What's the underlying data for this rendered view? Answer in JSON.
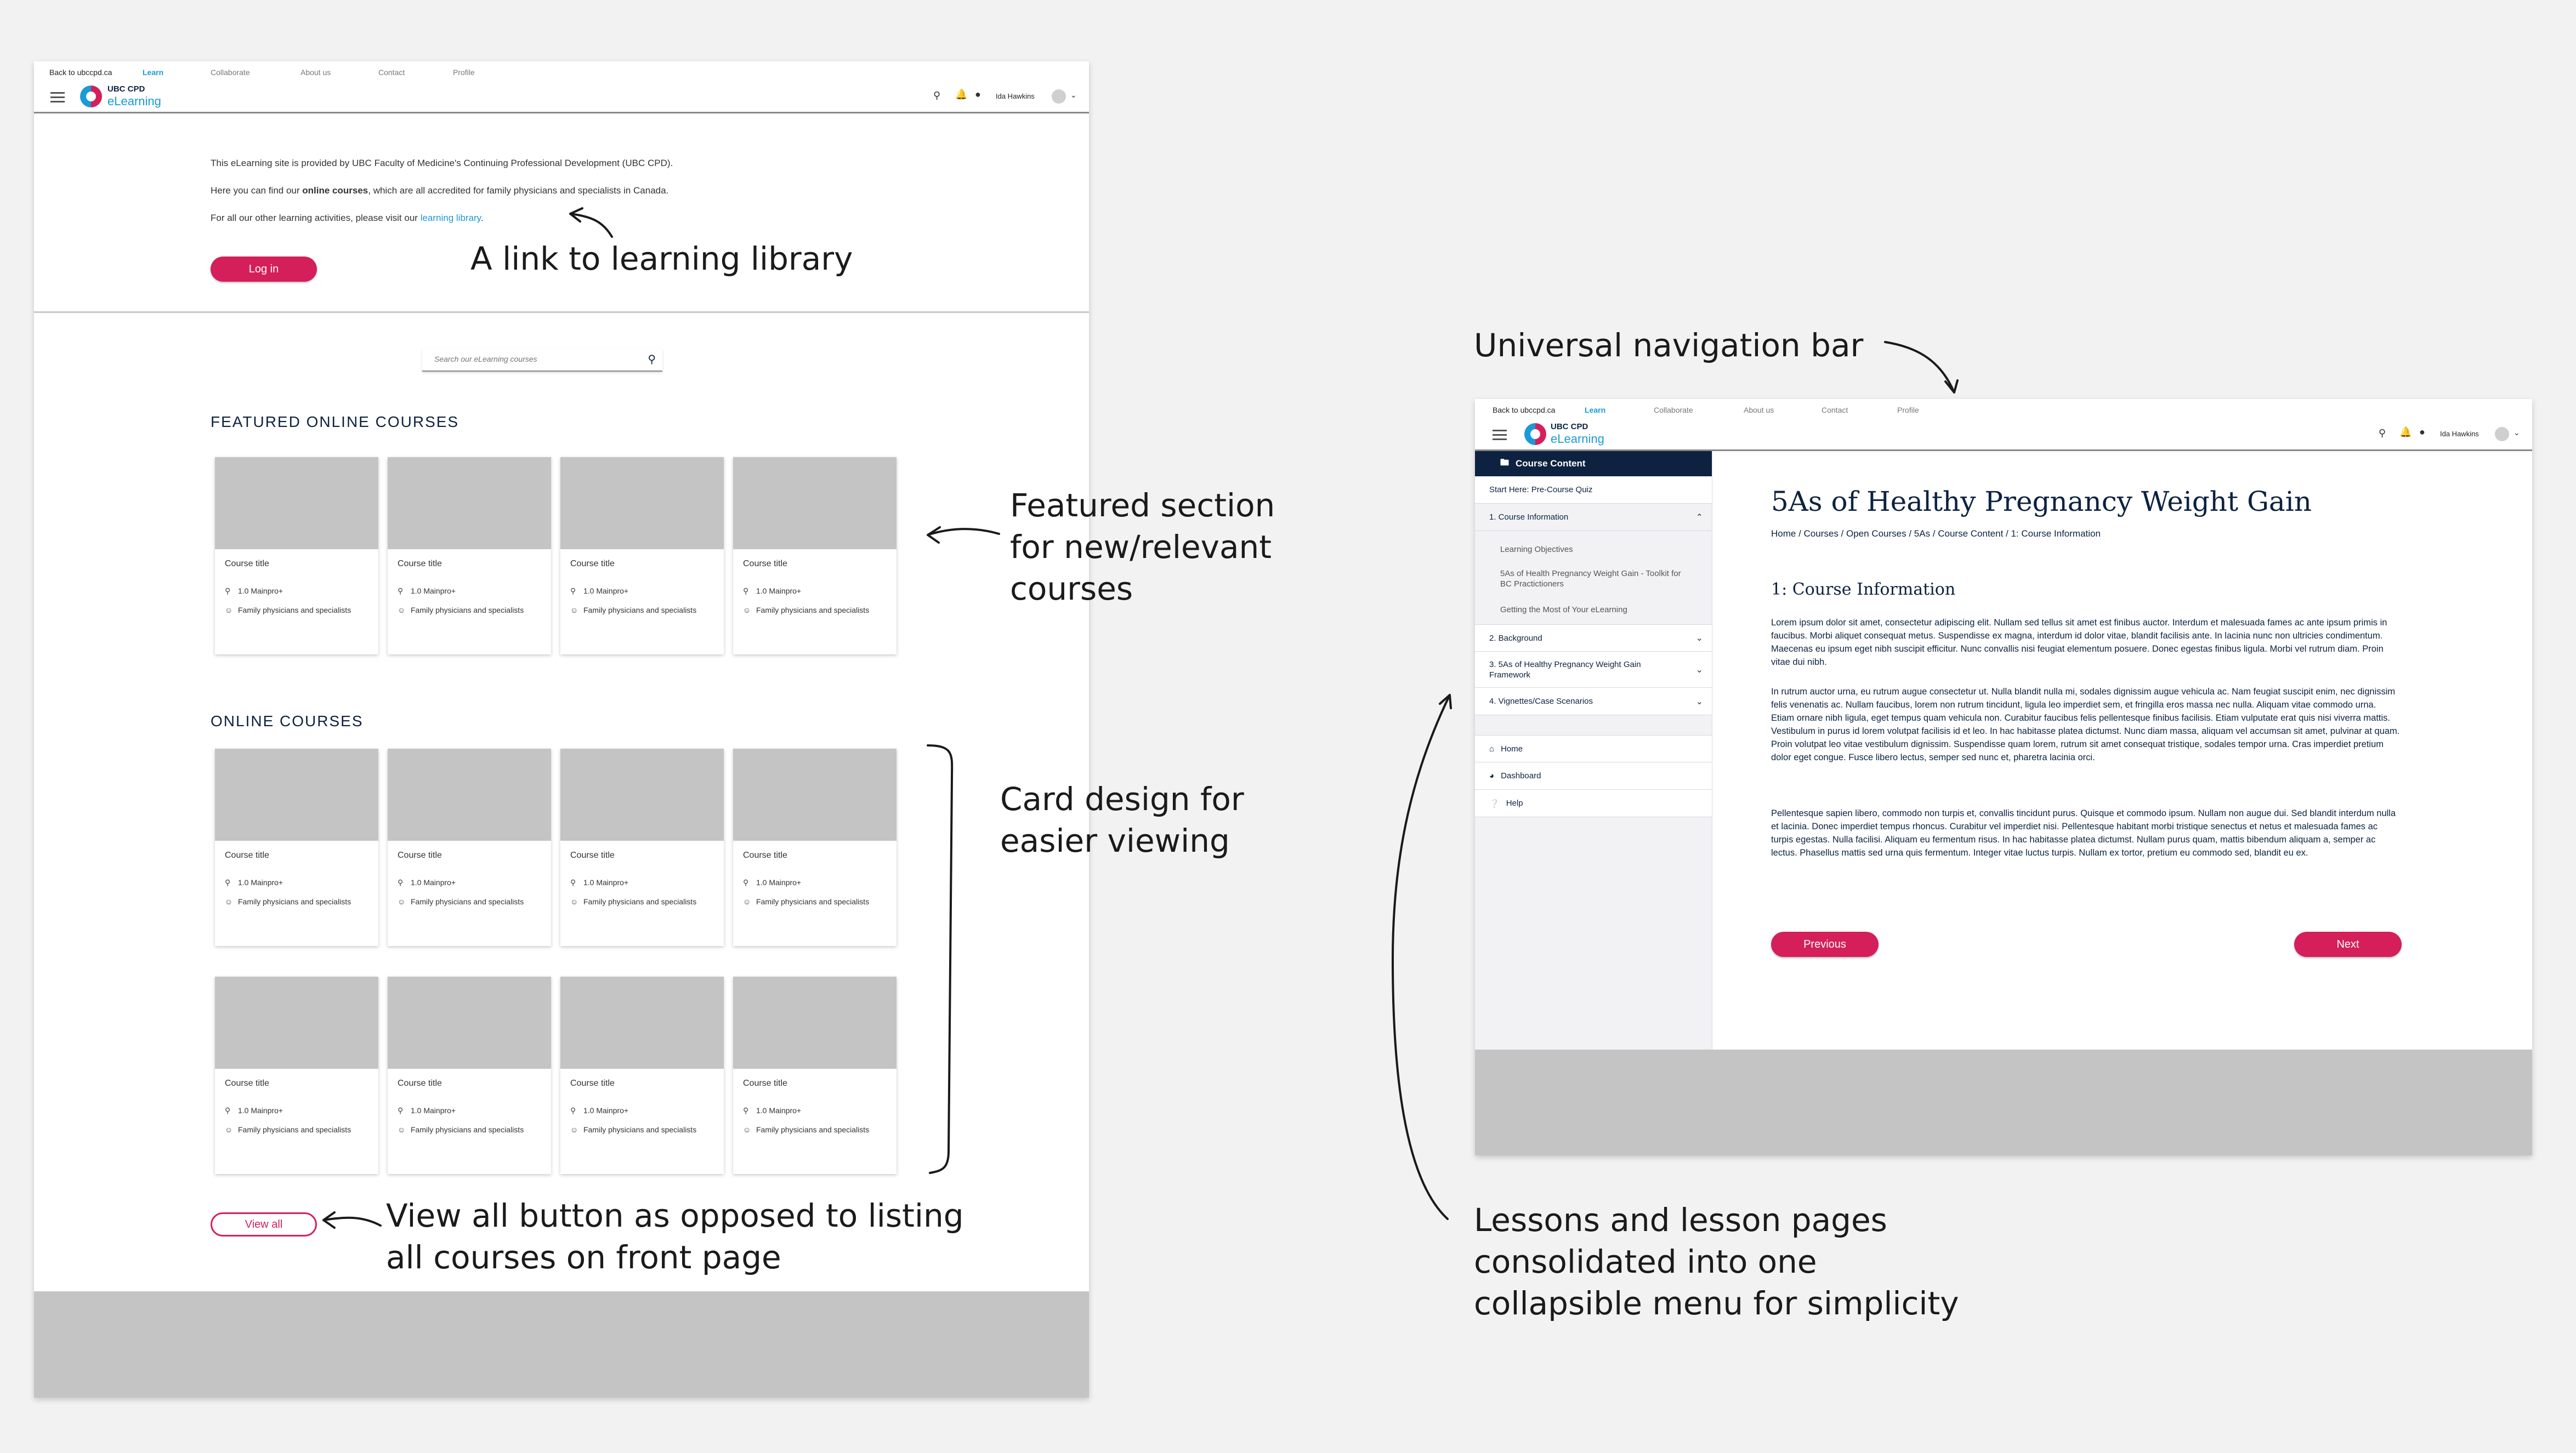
{
  "nav": {
    "back_link": "Back to ubccpd.ca",
    "learn": "Learn",
    "collaborate": "Collaborate",
    "about": "About us",
    "contact": "Contact",
    "profile": "Profile",
    "logo_line1": "UBC CPD",
    "logo_line2": "eLearning",
    "user_name": "Ida Hawkins"
  },
  "landing": {
    "intro_line1": "This eLearning site is provided by UBC Faculty of Medicine's Continuing Professional Development (UBC CPD).",
    "intro_line2_pre": "Here you can find our ",
    "intro_line2_bold": "online courses",
    "intro_line2_post": ", which are all accredited for family physicians and specialists in Canada.",
    "intro_line3_pre": "For all our other learning activities, please visit our ",
    "intro_line3_link": "learning library",
    "intro_line3_post": ".",
    "login_label": "Log in",
    "search_placeholder": "Search our eLearning courses",
    "featured_title": "FEATURED ONLINE COURSES",
    "online_title": "ONLINE COURSES",
    "view_all_label": "View all",
    "card": {
      "title": "Course title",
      "credits": "1.0 Mainpro+",
      "audience": "Family physicians and specialists"
    }
  },
  "lesson": {
    "sidebar_header": "Course Content",
    "start_item": "Start Here: Pre-Course Quiz",
    "section1": "1. Course Information",
    "sub1": "Learning Objectives",
    "sub2": "5As of Health Pregnancy Weight Gain - Toolkit for BC Practictioners",
    "sub3": "Getting the Most of Your eLearning",
    "section2": "2. Background",
    "section3": "3. 5As of Healthy Pregnancy Weight Gain Framework",
    "section4": "4. Vignettes/Case Scenarios",
    "home": "Home",
    "dashboard": "Dashboard",
    "help": "Help",
    "title": "5As of Healthy Pregnancy Weight Gain",
    "breadcrumb": "Home / Courses / Open Courses / 5As / Course Content / 1: Course Information",
    "heading": "1: Course Information",
    "para1": "Lorem ipsum dolor sit amet, consectetur adipiscing elit. Nullam sed tellus sit amet est finibus auctor. Interdum et malesuada fames ac ante ipsum primis in faucibus. Morbi aliquet consequat metus. Suspendisse ex magna, interdum id dolor vitae, blandit facilisis ante. In lacinia nunc non ultricies condimentum. Maecenas eu ipsum eget nibh suscipit efficitur. Nunc convallis nisi feugiat elementum posuere. Donec egestas finibus ligula. Morbi vel rutrum diam. Proin vitae dui nibh.",
    "para2": "In rutrum auctor urna, eu rutrum augue consectetur ut. Nulla blandit nulla mi, sodales dignissim augue vehicula ac. Nam feugiat suscipit enim, nec dignissim felis venenatis ac. Nullam faucibus, lorem non rutrum tincidunt, ligula leo imperdiet sem, et fringilla eros massa nec nulla. Aliquam vitae commodo urna. Etiam ornare nibh ligula, eget tempus quam vehicula non. Curabitur faucibus felis pellentesque finibus facilisis. Etiam vulputate erat quis nisi viverra mattis. Vestibulum in purus id lorem volutpat facilisis id et leo. In hac habitasse platea dictumst. Nunc diam massa, aliquam vel accumsan sit amet, pulvinar at quam. Proin volutpat leo vitae vestibulum dignissim. Suspendisse quam lorem, rutrum sit amet consequat tristique, sodales tempor urna. Cras imperdiet pretium dolor eget congue. Fusce libero lectus, semper sed nunc et, pharetra lacinia orci.",
    "para3": "Pellentesque sapien libero, commodo non turpis et, convallis tincidunt purus. Quisque et commodo ipsum. Nullam non augue dui. Sed blandit interdum nulla et lacinia. Donec imperdiet tempus rhoncus. Curabitur vel imperdiet nisi. Pellentesque habitant morbi tristique senectus et netus et malesuada fames ac turpis egestas. Nulla facilisi. Aliquam eu fermentum risus. In hac habitasse platea dictumst. Nullam purus quam, mattis bibendum aliquam a, semper ac lectus. Phasellus mattis sed urna quis fermentum. Integer vitae luctus turpis. Nullam ex tortor, pretium eu commodo sed, blandit eu ex.",
    "previous_label": "Previous",
    "next_label": "Next"
  },
  "annotations": {
    "library_link": "A link to learning library",
    "featured_line1": "Featured section",
    "featured_line2": "for new/relevant",
    "featured_line3": "courses",
    "card_line1": "Card design for",
    "card_line2": "easier viewing",
    "viewall_line1": "View all button as opposed to listing",
    "viewall_line2": "all courses on front page",
    "universal_nav": "Universal navigation bar",
    "lessons_line1": "Lessons and lesson pages",
    "lessons_line2": "consolidated into one",
    "lessons_line3": "collapsible menu for simplicity"
  },
  "colors": {
    "brand_pink": "#d41f5b",
    "brand_blue": "#1a9ad6",
    "navy": "#0d2240",
    "placeholder_gray": "#c4c4c4"
  }
}
